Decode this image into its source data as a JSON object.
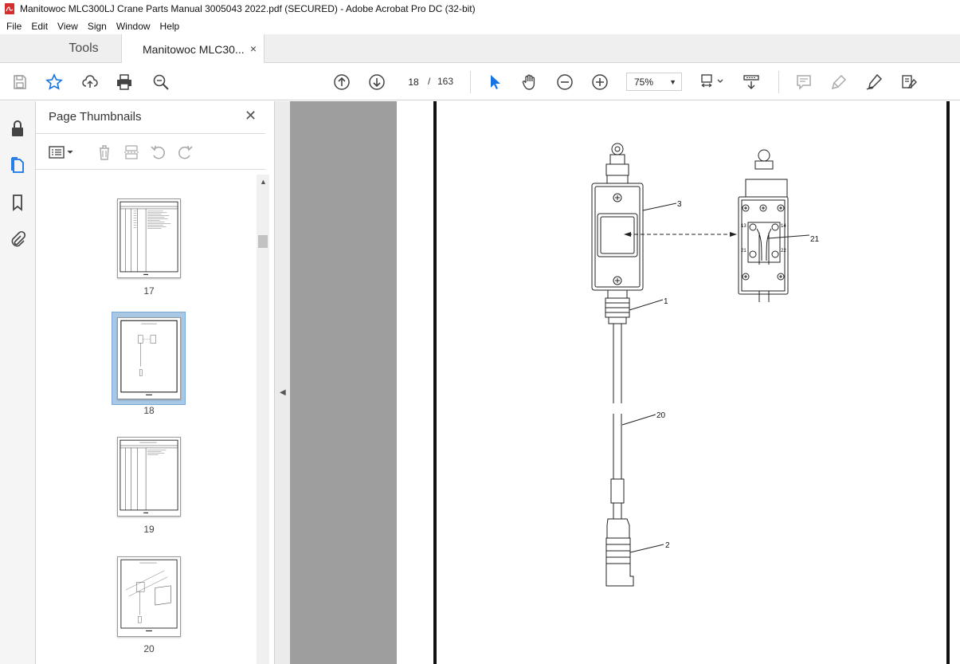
{
  "window": {
    "title": "Manitowoc MLC300LJ Crane Parts Manual 3005043 2022.pdf (SECURED) - Adobe Acrobat Pro DC (32-bit)"
  },
  "menu": [
    "File",
    "Edit",
    "View",
    "Sign",
    "Window",
    "Help"
  ],
  "tabs": {
    "tools": "Tools",
    "document": "Manitowoc MLC30...",
    "close_glyph": "×"
  },
  "toolbar": {
    "icons": [
      "save-icon",
      "bookmark-star-icon",
      "share-upload-icon",
      "print-icon",
      "find-zoom-icon",
      "page-up-icon",
      "page-down-icon",
      "select-cursor-icon",
      "hand-tool-icon",
      "zoom-out-icon",
      "zoom-in-icon",
      "fit-page-icon",
      "scroll-mode-icon",
      "comment-icon",
      "highlight-icon",
      "sign-icon",
      "fill-sign-icon"
    ],
    "current_page": "18",
    "page_separator": "/",
    "total_pages": "163",
    "zoom": "75%"
  },
  "left_rail": [
    "lock-icon",
    "page-thumbnails-icon",
    "bookmarks-icon",
    "attachments-icon"
  ],
  "thumbnails_panel": {
    "title": "Page Thumbnails",
    "close_glyph": "✕",
    "pages": [
      {
        "label": "17",
        "selected": false
      },
      {
        "label": "18",
        "selected": true
      },
      {
        "label": "19",
        "selected": false
      },
      {
        "label": "20",
        "selected": false
      }
    ]
  },
  "document": {
    "callouts": [
      "3",
      "21",
      "1",
      "20",
      "2"
    ],
    "terminal_labels": [
      "13",
      "14",
      "21",
      "22"
    ]
  },
  "colors": {
    "accent_blue": "#1473e6",
    "selected_thumb": "#a8c8e6",
    "doc_background": "#9e9e9e"
  }
}
